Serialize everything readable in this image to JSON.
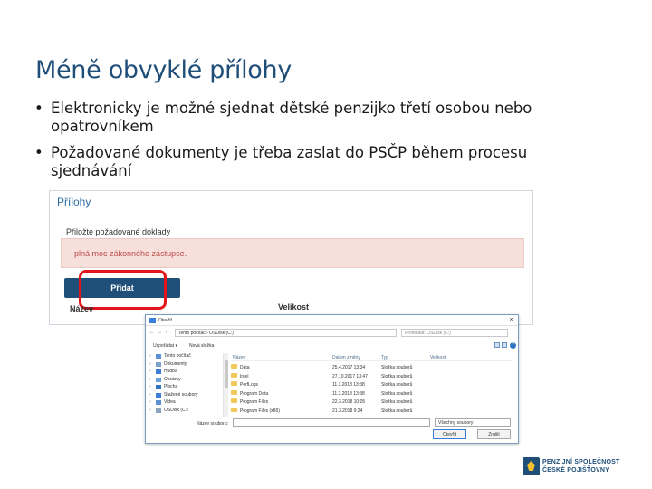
{
  "slide": {
    "title": "Méně obvyklé přílohy",
    "bullet_char": "•",
    "bullets": [
      "Elektronicky je možné sjednat dětské penzijko třetí osobou nebo opatrovníkem",
      "Požadované dokumenty je třeba zaslat do PSČP během procesu sjednávání"
    ]
  },
  "web_form": {
    "title": "Přílohy",
    "section_label": "Přiložte požadované doklady",
    "alert_text": "plná moc zákonného zástupce.",
    "add_button": "Přidat",
    "col_name": "Název",
    "col_size": "Velikost"
  },
  "dialog": {
    "title": "Otevřít",
    "close": "×",
    "nav": [
      "←",
      "→",
      "↑"
    ],
    "path": "Tento počítač › OSDisk (C:)",
    "search_placeholder": "Prohledat: OSDisk (C:)",
    "toolbar": {
      "organize": "Uspořádat ▾",
      "new_folder": "Nová složka",
      "help": "?"
    },
    "tree": [
      {
        "label": "Tento počítač",
        "icon": "computer-icon",
        "color": "#5b8fd6"
      },
      {
        "label": "Dokumenty",
        "icon": "documents-icon",
        "color": "#7aa2c8"
      },
      {
        "label": "Hudba",
        "icon": "music-icon",
        "color": "#3b7dd8"
      },
      {
        "label": "Obrázky",
        "icon": "pictures-icon",
        "color": "#6aa1d9"
      },
      {
        "label": "Plocha",
        "icon": "desktop-icon",
        "color": "#2f74c0"
      },
      {
        "label": "Stažené soubory",
        "icon": "downloads-icon",
        "color": "#3b7dd8"
      },
      {
        "label": "Videa",
        "icon": "videos-icon",
        "color": "#5b8fd6"
      },
      {
        "label": "OSDisk (C:)",
        "icon": "drive-icon",
        "color": "#8aa4bf"
      }
    ],
    "columns": {
      "name": "Název",
      "date": "Datum změny",
      "type": "Typ",
      "size": "Velikost"
    },
    "files": [
      {
        "name": "Data",
        "date": "25.4.2017 13:34",
        "type": "Složka souborů"
      },
      {
        "name": "Intel",
        "date": "27.10.2017 13:47",
        "type": "Složka souborů"
      },
      {
        "name": "PerfLogs",
        "date": "11.3.2018 13:38",
        "type": "Složka souborů"
      },
      {
        "name": "Program Data",
        "date": "11.3.2018 13:38",
        "type": "Složka souborů"
      },
      {
        "name": "Program Files",
        "date": "22.3.2018 10:05",
        "type": "Složka souborů"
      },
      {
        "name": "Program Files (x86)",
        "date": "21.3.2018 9:24",
        "type": "Složka souborů"
      }
    ],
    "filename_label": "Název souboru:",
    "filter": "Všechny soubory",
    "open_button": "Otevřít",
    "cancel_button": "Zrušit"
  },
  "logo": {
    "line1": "PENZIJNÍ SPOLEČNOST",
    "line2": "ČESKÉ POJIŠŤOVNY"
  },
  "colors": {
    "title": "#1f4e79",
    "highlight": "#e3151a",
    "alert_bg": "#f7e0dc",
    "button": "#1f4e79"
  }
}
